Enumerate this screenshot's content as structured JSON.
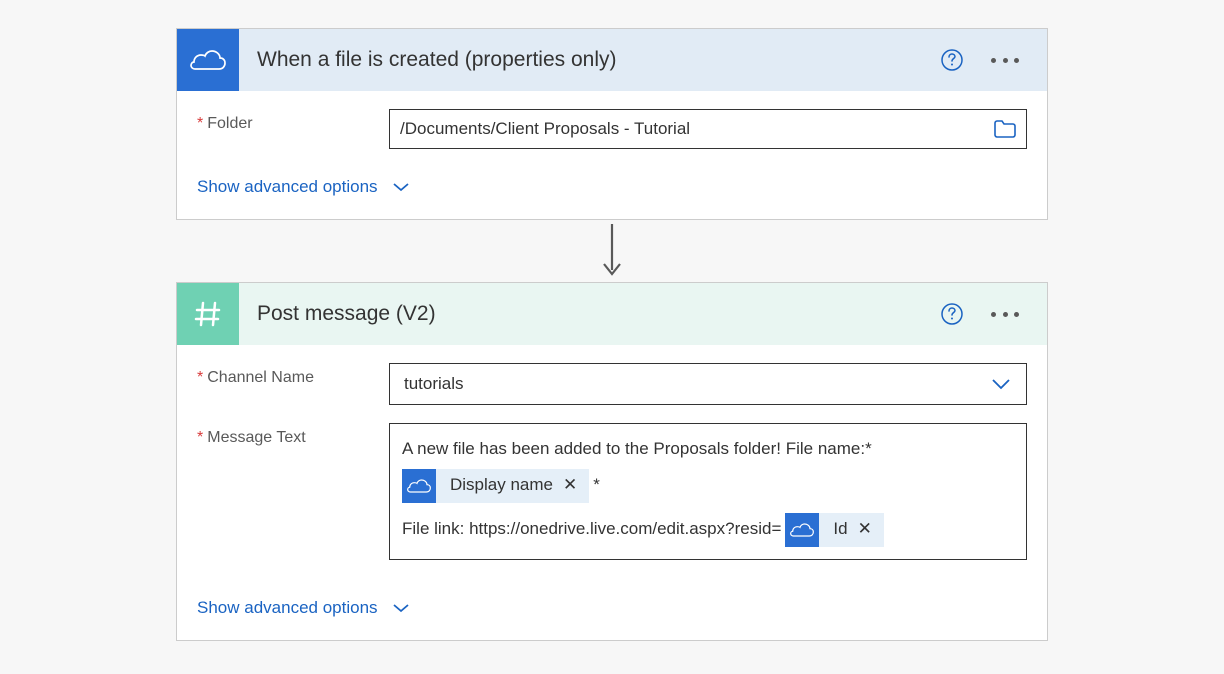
{
  "trigger": {
    "title": "When a file is created (properties only)",
    "folder_label": "Folder",
    "folder_value": "/Documents/Client Proposals - Tutorial",
    "advanced_label": "Show advanced options"
  },
  "action": {
    "title": "Post message (V2)",
    "channel_label": "Channel Name",
    "channel_value": "tutorials",
    "message_label": "Message Text",
    "message_text_1": "A new file has been added to the Proposals folder!  File name:*",
    "token_display_name": "Display name",
    "message_text_asterisk": "*",
    "message_text_2_prefix": "File link: https://onedrive.live.com/edit.aspx?resid=",
    "token_id": "Id",
    "advanced_label": "Show advanced options"
  }
}
